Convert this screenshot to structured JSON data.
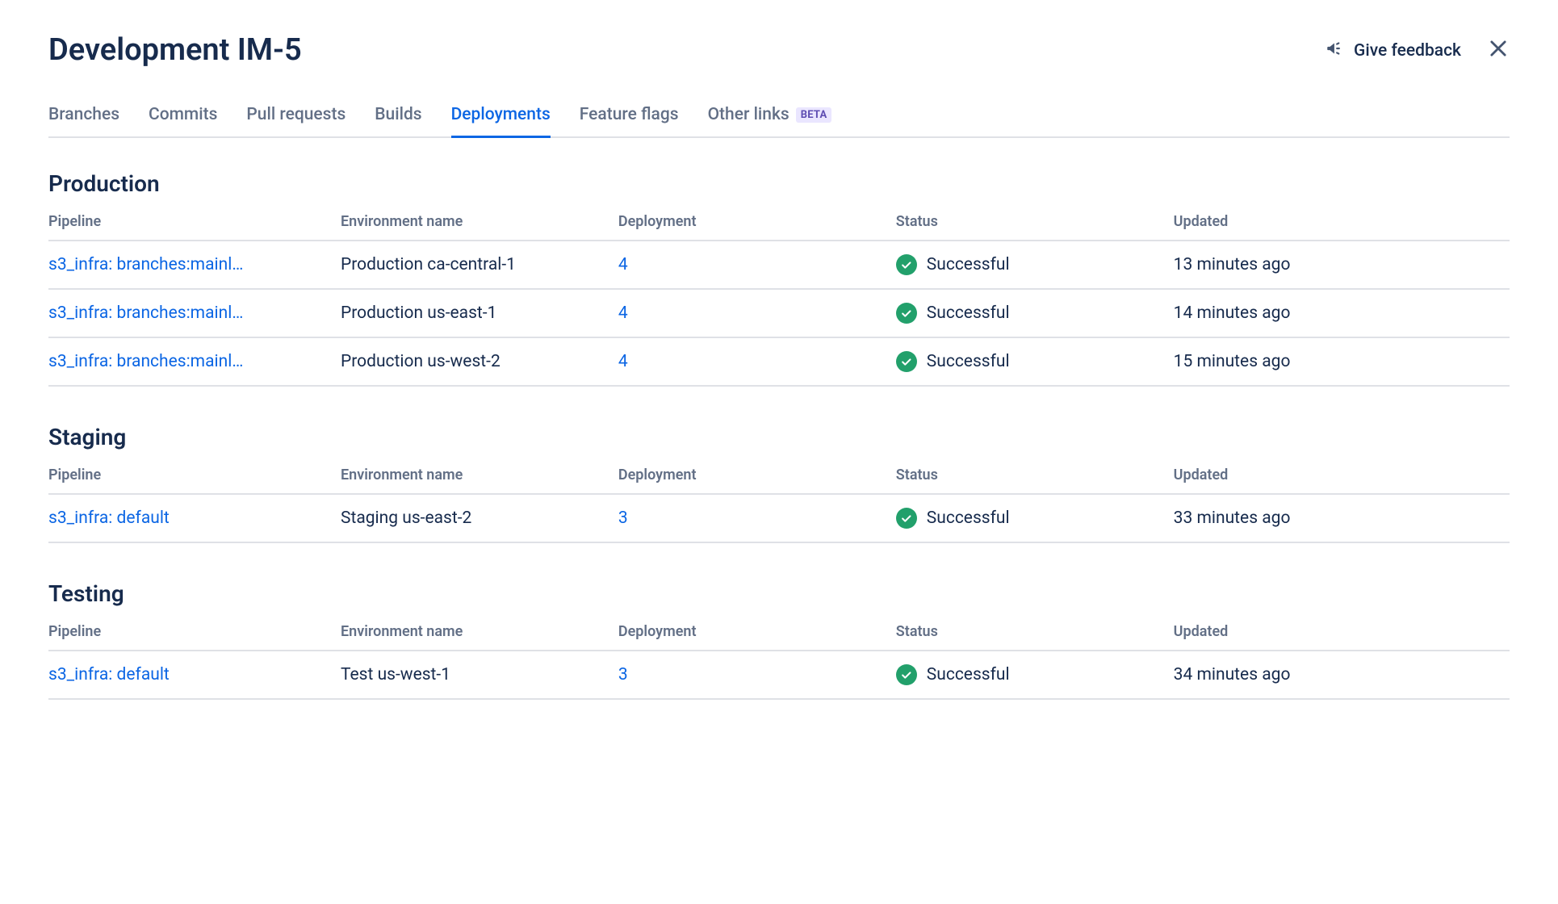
{
  "header": {
    "title": "Development IM-5",
    "feedback_label": "Give feedback"
  },
  "tabs": [
    {
      "label": "Branches",
      "active": false,
      "badge": null
    },
    {
      "label": "Commits",
      "active": false,
      "badge": null
    },
    {
      "label": "Pull requests",
      "active": false,
      "badge": null
    },
    {
      "label": "Builds",
      "active": false,
      "badge": null
    },
    {
      "label": "Deployments",
      "active": true,
      "badge": null
    },
    {
      "label": "Feature flags",
      "active": false,
      "badge": null
    },
    {
      "label": "Other links",
      "active": false,
      "badge": "BETA"
    }
  ],
  "columns": {
    "pipeline": "Pipeline",
    "env": "Environment name",
    "deployment": "Deployment",
    "status": "Status",
    "updated": "Updated"
  },
  "sections": [
    {
      "title": "Production",
      "rows": [
        {
          "pipeline": "s3_infra: branches:mainl…",
          "env": "Production ca-central-1",
          "deployment": "4",
          "status": "Successful",
          "updated": "13 minutes ago"
        },
        {
          "pipeline": "s3_infra: branches:mainl…",
          "env": "Production us-east-1",
          "deployment": "4",
          "status": "Successful",
          "updated": "14 minutes ago"
        },
        {
          "pipeline": "s3_infra: branches:mainl…",
          "env": "Production us-west-2",
          "deployment": "4",
          "status": "Successful",
          "updated": "15 minutes ago"
        }
      ]
    },
    {
      "title": "Staging",
      "rows": [
        {
          "pipeline": "s3_infra: default",
          "env": "Staging us-east-2",
          "deployment": "3",
          "status": "Successful",
          "updated": "33 minutes ago"
        }
      ]
    },
    {
      "title": "Testing",
      "rows": [
        {
          "pipeline": "s3_infra: default",
          "env": "Test us-west-1",
          "deployment": "3",
          "status": "Successful",
          "updated": "34 minutes ago"
        }
      ]
    }
  ]
}
